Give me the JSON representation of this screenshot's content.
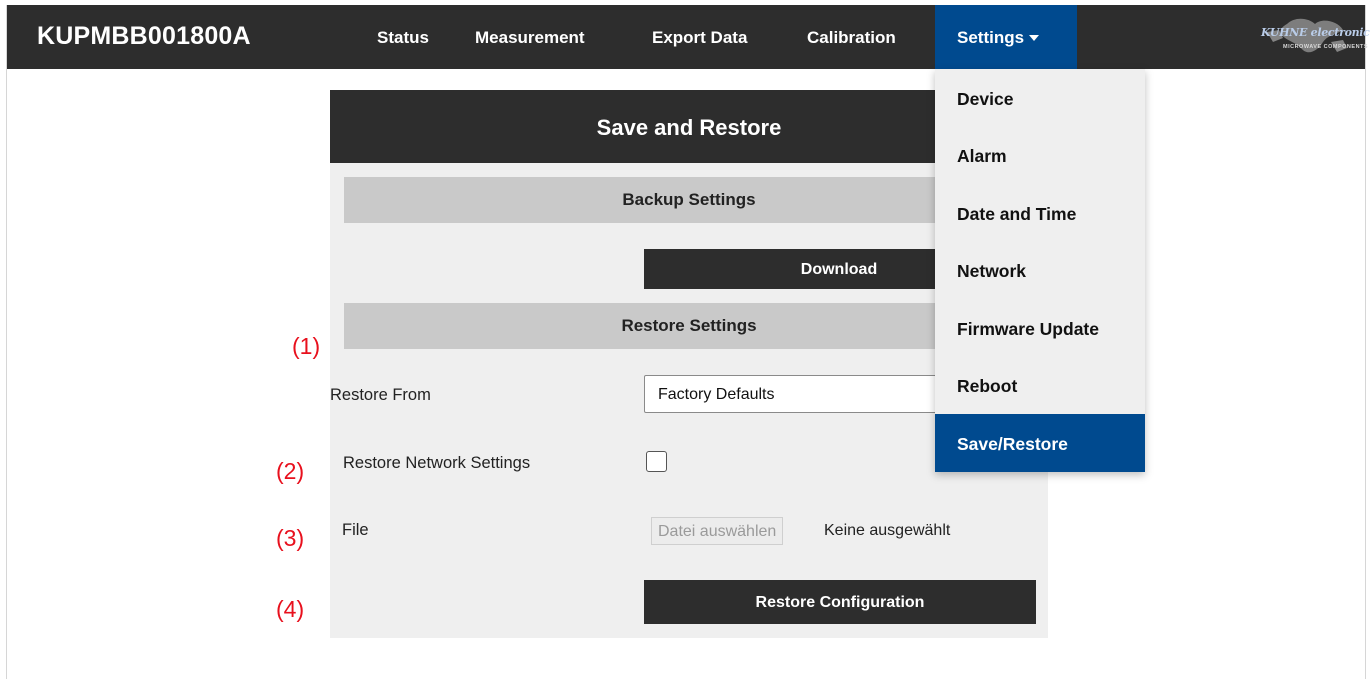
{
  "brand": "KUPMBB001800A",
  "nav": {
    "items": [
      "Status",
      "Measurement",
      "Export Data",
      "Calibration"
    ],
    "settings_label": "Settings"
  },
  "logo": {
    "text": "KUHNE electronic",
    "subtext": "MICROWAVE COMPONENTS"
  },
  "panel": {
    "title": "Save and Restore",
    "backup_section": "Backup Settings",
    "download_label": "Download",
    "restore_section": "Restore Settings",
    "restore_from_label": "Restore From",
    "restore_from_value": "Factory Defaults",
    "restore_network_label": "Restore Network Settings",
    "file_label": "File",
    "file_button": "Datei auswählen",
    "file_status": "Keine ausgewählt",
    "restore_config_label": "Restore Configuration"
  },
  "annotations": [
    "(1)",
    "(2)",
    "(3)",
    "(4)"
  ],
  "dropdown": {
    "items": [
      "Device",
      "Alarm",
      "Date and Time",
      "Network",
      "Firmware Update",
      "Reboot",
      "Save/Restore"
    ],
    "active": "Save/Restore"
  },
  "colors": {
    "navbar": "#2d2d2d",
    "accent": "#004a8f",
    "annotation": "#e8101d"
  }
}
